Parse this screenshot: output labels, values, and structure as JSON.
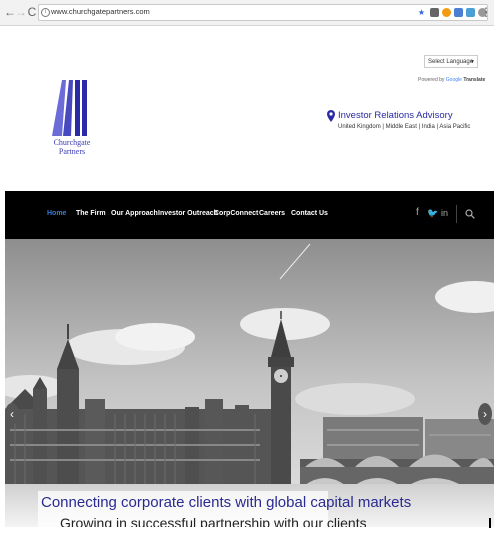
{
  "browser": {
    "back": "←",
    "forward": "→",
    "reload": "C",
    "url": "www.churchgatepartners.com"
  },
  "header": {
    "language_select": "Select Language",
    "powered_by": "Powered by",
    "google": "Google",
    "translate": "Translate",
    "logo_line1": "Churchgate",
    "logo_line2": "Partners",
    "advisory_title": "Investor Relations Advisory",
    "advisory_regions": "United Kingdom | Middle East | India | Asia Pacific"
  },
  "nav": {
    "items": [
      "Home",
      "The Firm",
      "Our Approach",
      "Investor Outreach",
      "CorpConnect",
      "Careers",
      "Contact Us"
    ],
    "social": [
      "f",
      "t",
      "in"
    ]
  },
  "hero": {
    "caption_line1": "Connecting corporate clients with global capital markets",
    "caption_line2": "Growing in successful partnership with our clients"
  },
  "colors": {
    "brand_blue": "#2a2aa5",
    "nav_bg": "#000000",
    "nav_active": "#3a7bd5"
  }
}
